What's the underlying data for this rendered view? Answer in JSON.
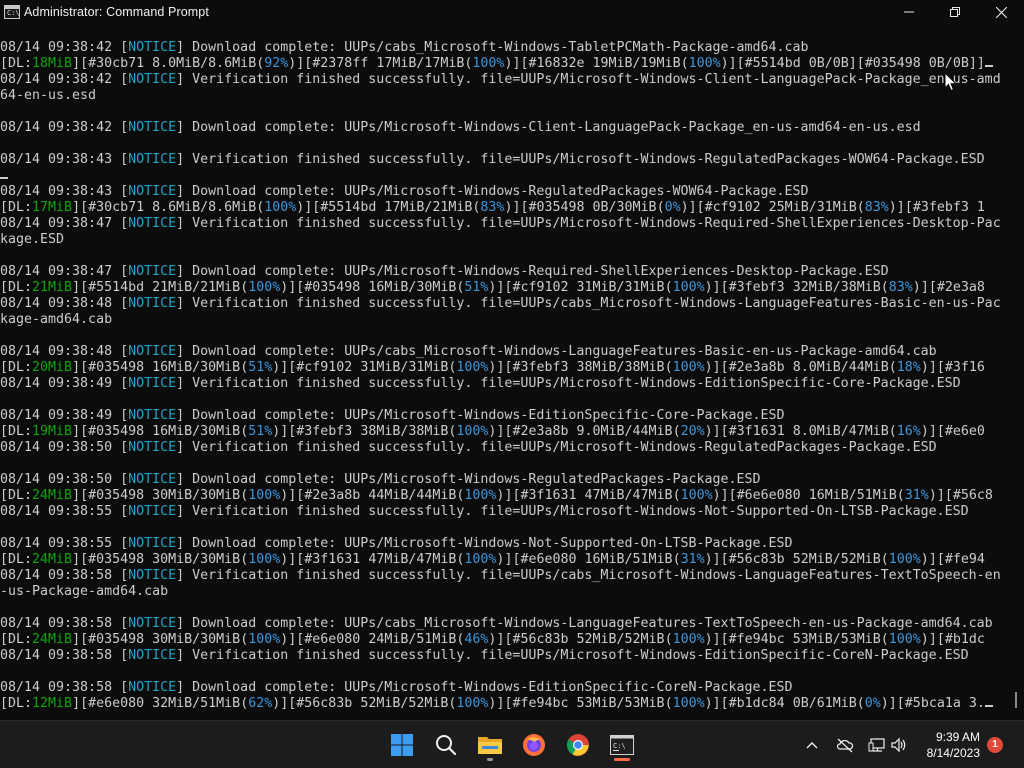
{
  "window": {
    "title": "Administrator: Command Prompt",
    "icon_label": "C:\\",
    "controls": [
      "minimize-icon",
      "maximize-icon",
      "close-icon"
    ]
  },
  "colors": {
    "background": "#0c0c0c",
    "text": "#cccccc",
    "notice": "#1ca5c7",
    "dl_speed": "#13a10e",
    "percent": "#3a96dd",
    "taskbar": "#1c1c1c"
  },
  "console_lines": [
    {
      "kind": "complete",
      "time": "08/14 09:38:42",
      "text": " Download complete: UUPs/cabs_Microsoft-Windows-TabletPCMath-Package-amd64.cab"
    },
    {
      "kind": "progress",
      "speed": "18MiB",
      "items": [
        {
          "id": "#30cb71",
          "size": "8.0MiB/8.6MiB",
          "pct": "92%"
        },
        {
          "id": "#2378ff",
          "size": "17MiB/17MiB",
          "pct": "100%"
        },
        {
          "id": "#16832e",
          "size": "19MiB/19MiB",
          "pct": "100%"
        },
        {
          "id": "#5514bd",
          "size": "0B/0B",
          "pct": null
        },
        {
          "id": "#035498",
          "size": "0B/0B",
          "pct": null
        }
      ],
      "tail": "]",
      "cursor": true
    },
    {
      "kind": "verify",
      "time": "08/14 09:38:42",
      "text": " Verification finished successfully. file=UUPs/Microsoft-Windows-Client-LanguagePack-Package_en-us-amd"
    },
    {
      "kind": "plain",
      "text": "64-en-us.esd"
    },
    {
      "kind": "blank"
    },
    {
      "kind": "complete",
      "time": "08/14 09:38:42",
      "text": " Download complete: UUPs/Microsoft-Windows-Client-LanguagePack-Package_en-us-amd64-en-us.esd"
    },
    {
      "kind": "blank"
    },
    {
      "kind": "verify",
      "time": "08/14 09:38:43",
      "text": " Verification finished successfully. file=UUPs/Microsoft-Windows-RegulatedPackages-WOW64-Package.ESD"
    },
    {
      "kind": "blank",
      "cursor": true
    },
    {
      "kind": "complete",
      "time": "08/14 09:38:43",
      "text": " Download complete: UUPs/Microsoft-Windows-RegulatedPackages-WOW64-Package.ESD"
    },
    {
      "kind": "progress",
      "speed": "17MiB",
      "items": [
        {
          "id": "#30cb71",
          "size": "8.6MiB/8.6MiB",
          "pct": "100%"
        },
        {
          "id": "#5514bd",
          "size": "17MiB/21MiB",
          "pct": "83%"
        },
        {
          "id": "#035498",
          "size": "0B/30MiB",
          "pct": "0%"
        },
        {
          "id": "#cf9102",
          "size": "25MiB/31MiB",
          "pct": "83%"
        }
      ],
      "tail": "[#3febf3 1"
    },
    {
      "kind": "verify",
      "time": "08/14 09:38:47",
      "text": " Verification finished successfully. file=UUPs/Microsoft-Windows-Required-ShellExperiences-Desktop-Pac"
    },
    {
      "kind": "plain",
      "text": "kage.ESD"
    },
    {
      "kind": "blank"
    },
    {
      "kind": "complete",
      "time": "08/14 09:38:47",
      "text": " Download complete: UUPs/Microsoft-Windows-Required-ShellExperiences-Desktop-Package.ESD"
    },
    {
      "kind": "progress",
      "speed": "21MiB",
      "items": [
        {
          "id": "#5514bd",
          "size": "21MiB/21MiB",
          "pct": "100%"
        },
        {
          "id": "#035498",
          "size": "16MiB/30MiB",
          "pct": "51%"
        },
        {
          "id": "#cf9102",
          "size": "31MiB/31MiB",
          "pct": "100%"
        },
        {
          "id": "#3febf3",
          "size": "32MiB/38MiB",
          "pct": "83%"
        }
      ],
      "tail": "[#2e3a8"
    },
    {
      "kind": "verify",
      "time": "08/14 09:38:48",
      "text": " Verification finished successfully. file=UUPs/cabs_Microsoft-Windows-LanguageFeatures-Basic-en-us-Pac"
    },
    {
      "kind": "plain",
      "text": "kage-amd64.cab"
    },
    {
      "kind": "blank"
    },
    {
      "kind": "complete",
      "time": "08/14 09:38:48",
      "text": " Download complete: UUPs/cabs_Microsoft-Windows-LanguageFeatures-Basic-en-us-Package-amd64.cab"
    },
    {
      "kind": "progress",
      "speed": "20MiB",
      "items": [
        {
          "id": "#035498",
          "size": "16MiB/30MiB",
          "pct": "51%"
        },
        {
          "id": "#cf9102",
          "size": "31MiB/31MiB",
          "pct": "100%"
        },
        {
          "id": "#3febf3",
          "size": "38MiB/38MiB",
          "pct": "100%"
        },
        {
          "id": "#2e3a8b",
          "size": "8.0MiB/44MiB",
          "pct": "18%"
        }
      ],
      "tail": "[#3f16"
    },
    {
      "kind": "verify",
      "time": "08/14 09:38:49",
      "text": " Verification finished successfully. file=UUPs/Microsoft-Windows-EditionSpecific-Core-Package.ESD"
    },
    {
      "kind": "blank"
    },
    {
      "kind": "complete",
      "time": "08/14 09:38:49",
      "text": " Download complete: UUPs/Microsoft-Windows-EditionSpecific-Core-Package.ESD"
    },
    {
      "kind": "progress",
      "speed": "19MiB",
      "items": [
        {
          "id": "#035498",
          "size": "16MiB/30MiB",
          "pct": "51%"
        },
        {
          "id": "#3febf3",
          "size": "38MiB/38MiB",
          "pct": "100%"
        },
        {
          "id": "#2e3a8b",
          "size": "9.0MiB/44MiB",
          "pct": "20%"
        },
        {
          "id": "#3f1631",
          "size": "8.0MiB/47MiB",
          "pct": "16%"
        }
      ],
      "tail": "[#e6e0"
    },
    {
      "kind": "verify",
      "time": "08/14 09:38:50",
      "text": " Verification finished successfully. file=UUPs/Microsoft-Windows-RegulatedPackages-Package.ESD"
    },
    {
      "kind": "blank"
    },
    {
      "kind": "complete",
      "time": "08/14 09:38:50",
      "text": " Download complete: UUPs/Microsoft-Windows-RegulatedPackages-Package.ESD"
    },
    {
      "kind": "progress",
      "speed": "24MiB",
      "items": [
        {
          "id": "#035498",
          "size": "30MiB/30MiB",
          "pct": "100%"
        },
        {
          "id": "#2e3a8b",
          "size": "44MiB/44MiB",
          "pct": "100%"
        },
        {
          "id": "#3f1631",
          "size": "47MiB/47MiB",
          "pct": "100%"
        },
        {
          "id": "#6e6e080",
          "size": "16MiB/51MiB",
          "pct": "31%"
        }
      ],
      "tail": "[#56c8"
    },
    {
      "kind": "verify",
      "time": "08/14 09:38:55",
      "text": " Verification finished successfully. file=UUPs/Microsoft-Windows-Not-Supported-On-LTSB-Package.ESD"
    },
    {
      "kind": "blank"
    },
    {
      "kind": "complete",
      "time": "08/14 09:38:55",
      "text": " Download complete: UUPs/Microsoft-Windows-Not-Supported-On-LTSB-Package.ESD"
    },
    {
      "kind": "progress",
      "speed": "24MiB",
      "items": [
        {
          "id": "#035498",
          "size": "30MiB/30MiB",
          "pct": "100%"
        },
        {
          "id": "#3f1631",
          "size": "47MiB/47MiB",
          "pct": "100%"
        },
        {
          "id": "#e6e080",
          "size": "16MiB/51MiB",
          "pct": "31%"
        },
        {
          "id": "#56c83b",
          "size": "52MiB/52MiB",
          "pct": "100%"
        }
      ],
      "tail": "[#fe94"
    },
    {
      "kind": "verify",
      "time": "08/14 09:38:58",
      "text": " Verification finished successfully. file=UUPs/cabs_Microsoft-Windows-LanguageFeatures-TextToSpeech-en"
    },
    {
      "kind": "plain",
      "text": "-us-Package-amd64.cab"
    },
    {
      "kind": "blank"
    },
    {
      "kind": "complete",
      "time": "08/14 09:38:58",
      "text": " Download complete: UUPs/cabs_Microsoft-Windows-LanguageFeatures-TextToSpeech-en-us-Package-amd64.cab"
    },
    {
      "kind": "progress",
      "speed": "24MiB",
      "items": [
        {
          "id": "#035498",
          "size": "30MiB/30MiB",
          "pct": "100%"
        },
        {
          "id": "#e6e080",
          "size": "24MiB/51MiB",
          "pct": "46%"
        },
        {
          "id": "#56c83b",
          "size": "52MiB/52MiB",
          "pct": "100%"
        },
        {
          "id": "#fe94bc",
          "size": "53MiB/53MiB",
          "pct": "100%"
        }
      ],
      "tail": "[#b1dc"
    },
    {
      "kind": "verify",
      "time": "08/14 09:38:58",
      "text": " Verification finished successfully. file=UUPs/Microsoft-Windows-EditionSpecific-CoreN-Package.ESD"
    },
    {
      "kind": "blank"
    },
    {
      "kind": "complete",
      "time": "08/14 09:38:58",
      "text": " Download complete: UUPs/Microsoft-Windows-EditionSpecific-CoreN-Package.ESD"
    },
    {
      "kind": "progress",
      "speed": "12MiB",
      "items": [
        {
          "id": "#e6e080",
          "size": "32MiB/51MiB",
          "pct": "62%"
        },
        {
          "id": "#56c83b",
          "size": "52MiB/52MiB",
          "pct": "100%"
        },
        {
          "id": "#fe94bc",
          "size": "53MiB/53MiB",
          "pct": "100%"
        },
        {
          "id": "#b1dc84",
          "size": "0B/61MiB",
          "pct": "0%"
        }
      ],
      "tail": "[#5bca1a 3.",
      "cursor": true
    }
  ],
  "notice_tag": "NOTICE",
  "dl_prefix": "DL:",
  "taskbar": {
    "apps": [
      {
        "name": "start-button",
        "icon": "windows-logo-icon"
      },
      {
        "name": "search-button",
        "icon": "search-icon"
      },
      {
        "name": "file-explorer-button",
        "icon": "folder-icon"
      },
      {
        "name": "firefox-button",
        "icon": "firefox-icon"
      },
      {
        "name": "chrome-button",
        "icon": "chrome-icon"
      },
      {
        "name": "terminal-button",
        "icon": "terminal-icon"
      }
    ],
    "tray": {
      "time": "9:39 AM",
      "date": "8/14/2023",
      "notification_count": "1"
    }
  }
}
